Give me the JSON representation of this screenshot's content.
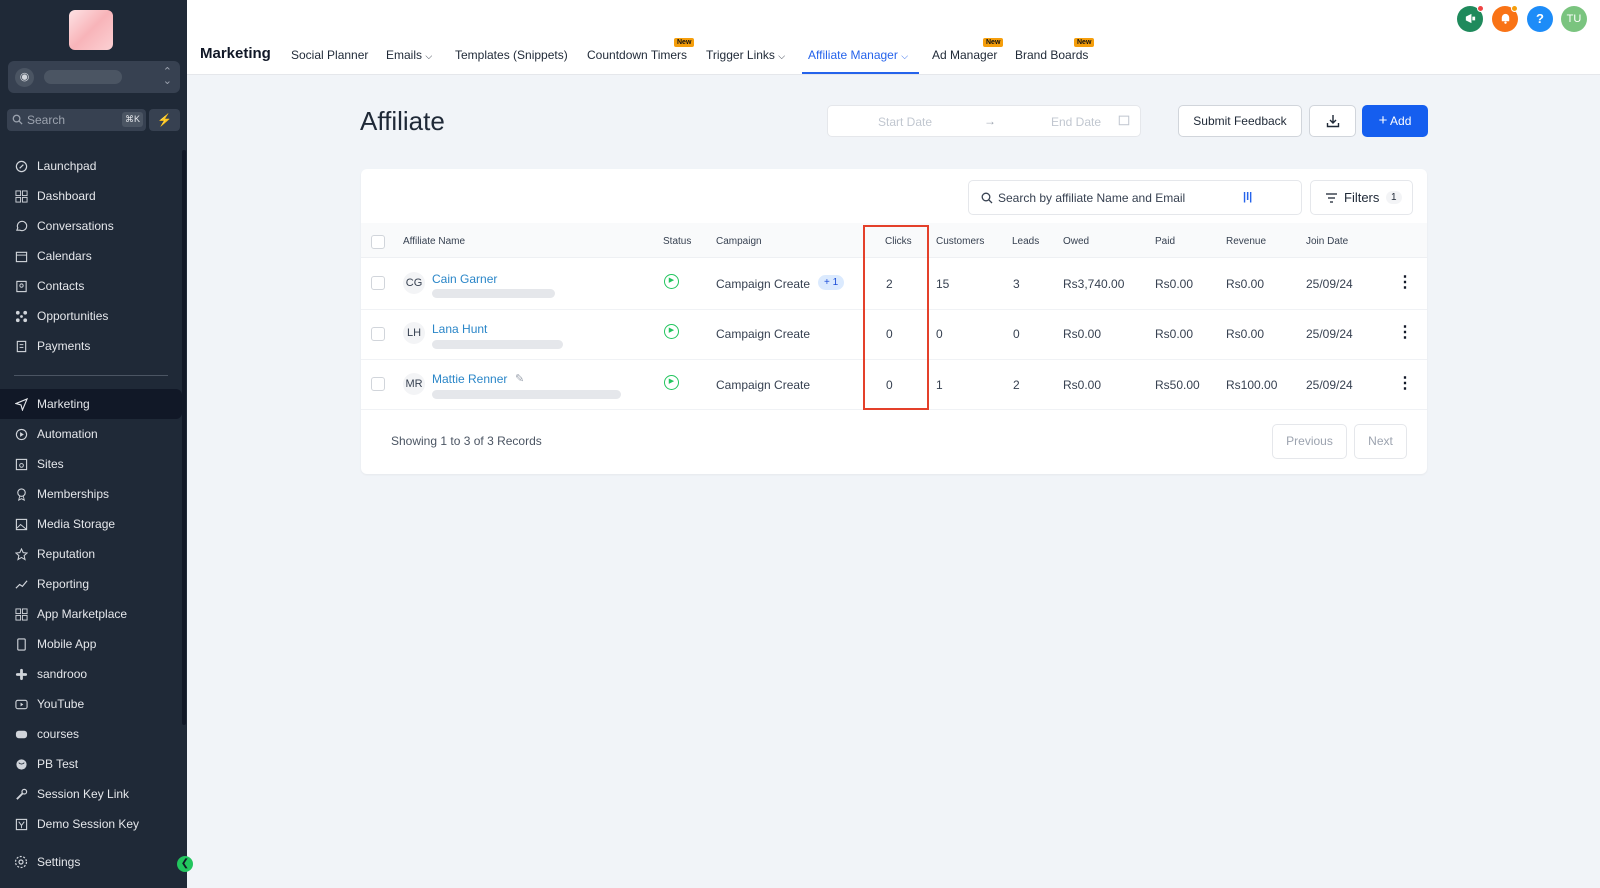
{
  "sidebar": {
    "account_icon": "user-circle-icon",
    "search_placeholder": "Search",
    "search_shortcut": "⌘K",
    "items": [
      {
        "label": "Launchpad",
        "icon": "rocket-icon"
      },
      {
        "label": "Dashboard",
        "icon": "grid-icon"
      },
      {
        "label": "Conversations",
        "icon": "chat-icon"
      },
      {
        "label": "Calendars",
        "icon": "calendar-icon"
      },
      {
        "label": "Contacts",
        "icon": "contacts-icon"
      },
      {
        "label": "Opportunities",
        "icon": "funnel-icon"
      },
      {
        "label": "Payments",
        "icon": "receipt-icon"
      },
      {
        "label": "Marketing",
        "icon": "send-icon"
      },
      {
        "label": "Automation",
        "icon": "automation-icon"
      },
      {
        "label": "Sites",
        "icon": "sites-icon"
      },
      {
        "label": "Memberships",
        "icon": "award-icon"
      },
      {
        "label": "Media Storage",
        "icon": "image-icon"
      },
      {
        "label": "Reputation",
        "icon": "star-icon"
      },
      {
        "label": "Reporting",
        "icon": "trend-icon"
      },
      {
        "label": "App Marketplace",
        "icon": "apps-icon"
      },
      {
        "label": "Mobile App",
        "icon": "mobile-icon"
      },
      {
        "label": "sandrooo",
        "icon": "slack-icon"
      },
      {
        "label": "YouTube",
        "icon": "youtube-icon"
      },
      {
        "label": "courses",
        "icon": "video-icon"
      },
      {
        "label": "PB Test",
        "icon": "globe-icon"
      },
      {
        "label": "Session Key Link",
        "icon": "wrench-icon"
      },
      {
        "label": "Demo Session Key",
        "icon": "yahoo-icon"
      },
      {
        "label": "Settings",
        "icon": "gear-icon"
      }
    ]
  },
  "topbar": {
    "title": "Marketing",
    "tabs": [
      {
        "label": "Social Planner"
      },
      {
        "label": "Emails"
      },
      {
        "label": "Templates (Snippets)"
      },
      {
        "label": "Countdown Timers",
        "badge": "New"
      },
      {
        "label": "Trigger Links"
      },
      {
        "label": "Affiliate Manager"
      },
      {
        "label": "Ad Manager",
        "badge": "New"
      },
      {
        "label": "Brand Boards",
        "badge": "New"
      }
    ],
    "user_initials": "TU",
    "help": "?"
  },
  "page": {
    "title": "Affiliate",
    "start_date_placeholder": "Start Date",
    "end_date_placeholder": "End Date",
    "submit_feedback": "Submit Feedback",
    "add_label": "Add",
    "search_placeholder": "Search by affiliate Name and Email",
    "filters_label": "Filters",
    "filters_count": "1"
  },
  "table": {
    "columns": [
      "Affiliate Name",
      "Status",
      "Campaign",
      "Clicks",
      "Customers",
      "Leads",
      "Owed",
      "Paid",
      "Revenue",
      "Join Date"
    ],
    "rows": [
      {
        "initials": "CG",
        "name": "Cain Garner",
        "campaign": "Campaign Create",
        "extra": "+ 1",
        "clicks": "2",
        "customers": "15",
        "leads": "3",
        "owed": "Rs3,740.00",
        "paid": "Rs0.00",
        "revenue": "Rs0.00",
        "join": "25/09/24"
      },
      {
        "initials": "LH",
        "name": "Lana Hunt",
        "campaign": "Campaign Create",
        "clicks": "0",
        "customers": "0",
        "leads": "0",
        "owed": "Rs0.00",
        "paid": "Rs0.00",
        "revenue": "Rs0.00",
        "join": "25/09/24"
      },
      {
        "initials": "MR",
        "name": "Mattie Renner",
        "campaign": "Campaign Create",
        "clicks": "0",
        "customers": "1",
        "leads": "2",
        "owed": "Rs0.00",
        "paid": "Rs50.00",
        "revenue": "Rs100.00",
        "join": "25/09/24"
      }
    ],
    "footer": "Showing 1 to 3 of 3 Records",
    "previous": "Previous",
    "next": "Next"
  },
  "colors": {
    "accent": "#155eef",
    "sidebar": "#1f2937",
    "highlight": "#e4402a",
    "status_active": "#22c55e"
  }
}
